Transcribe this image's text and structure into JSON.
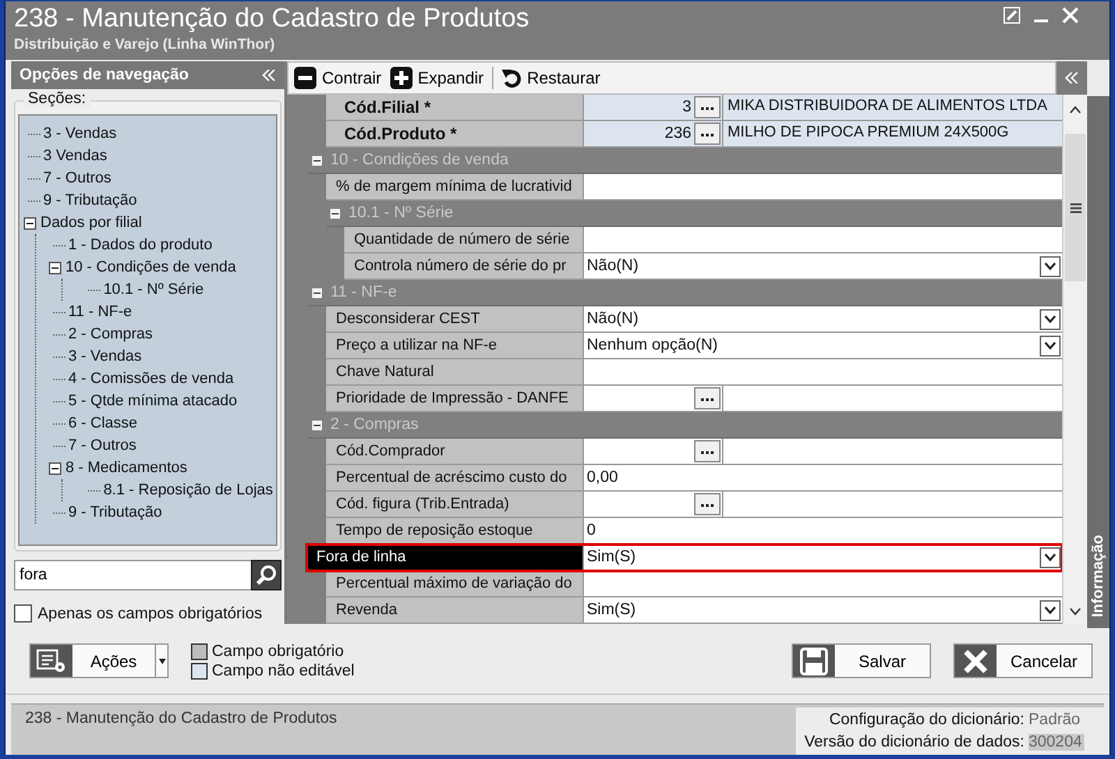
{
  "window": {
    "title": "238 - Manutenção do Cadastro de Produtos",
    "subtitle": "Distribuição e Varejo (Linha WinThor)"
  },
  "navigation": {
    "title": "Opções de navegação",
    "sections_label": "Seções:",
    "tree": [
      {
        "label": "3 - Vendas"
      },
      {
        "label": "3 Vendas"
      },
      {
        "label": "7 - Outros"
      },
      {
        "label": "9 - Tributação"
      },
      {
        "label": "Dados por filial",
        "expanded": true,
        "children": [
          {
            "label": "1 - Dados do produto"
          },
          {
            "label": "10 - Condições de venda",
            "expanded": true,
            "children": [
              {
                "label": "10.1 - Nº Série"
              }
            ]
          },
          {
            "label": "11 - NF-e"
          },
          {
            "label": "2 - Compras"
          },
          {
            "label": "3 - Vendas"
          },
          {
            "label": "4 - Comissões de venda"
          },
          {
            "label": "5 - Qtde mínima atacado"
          },
          {
            "label": "6 - Classe"
          },
          {
            "label": "7 - Outros"
          },
          {
            "label": "8 - Medicamentos",
            "expanded": true,
            "children": [
              {
                "label": "8.1 -  Reposição de Lojas"
              }
            ]
          },
          {
            "label": "9 - Tributação"
          }
        ]
      }
    ],
    "search": {
      "value": "fora"
    },
    "required_only": {
      "label": "Apenas os campos obrigatórios",
      "checked": false
    }
  },
  "toolbar": [
    {
      "kind": "collapse",
      "label": "Contrair"
    },
    {
      "kind": "expand",
      "label": "Expandir"
    },
    {
      "kind": "restore",
      "label": "Restaurar"
    }
  ],
  "grid": {
    "rows": [
      {
        "kind": "lookup",
        "label": "Cód.Filial *",
        "required": true,
        "selected": false,
        "value": "3",
        "description": "MIKA DISTRIBUIDORA DE ALIMENTOS LTDA"
      },
      {
        "kind": "lookup",
        "label": "Cód.Produto *",
        "required": true,
        "selected": false,
        "value": "236",
        "description": "MILHO DE PIPOCA PREMIUM 24X500G"
      },
      {
        "kind": "group",
        "title": "10 - Condições de venda",
        "expanded": true,
        "children": [
          {
            "kind": "text",
            "label": "% de margem mínima de lucrativid",
            "required": false,
            "selected": false
          },
          {
            "kind": "group",
            "title": "10.1 - Nº Série",
            "expanded": true,
            "children": [
              {
                "kind": "text",
                "label": "Quantidade de número de série",
                "required": false,
                "selected": false
              },
              {
                "kind": "dropdown",
                "label": "Controla número de série do pr",
                "required": false,
                "selected": false,
                "value": "Não(N)"
              }
            ]
          }
        ]
      },
      {
        "kind": "group",
        "title": "11 - NF-e",
        "expanded": true,
        "children": [
          {
            "kind": "dropdown",
            "label": "Desconsiderar CEST",
            "required": false,
            "selected": false,
            "value": "Não(N)"
          },
          {
            "kind": "dropdown",
            "label": "Preço a utilizar na NF-e",
            "required": false,
            "selected": false,
            "value": "Nenhum opção(N)"
          },
          {
            "kind": "text",
            "label": "Chave Natural",
            "required": false,
            "selected": false
          },
          {
            "kind": "lookup",
            "label": "Prioridade de Impressão - DANFE",
            "required": false,
            "selected": false
          }
        ]
      },
      {
        "kind": "group",
        "title": "2 - Compras",
        "expanded": true,
        "children": [
          {
            "kind": "lookup",
            "label": "Cód.Comprador",
            "required": false,
            "selected": false
          },
          {
            "kind": "text",
            "label": "Percentual de acréscimo custo do",
            "required": false,
            "selected": false,
            "value": "0,00"
          },
          {
            "kind": "lookup",
            "label": "Cód. figura (Trib.Entrada)",
            "required": false,
            "selected": false
          },
          {
            "kind": "text",
            "label": "Tempo de reposição estoque",
            "required": false,
            "selected": false,
            "value": "0"
          },
          {
            "kind": "dropdown",
            "label": "Fora de linha",
            "required": false,
            "selected": true,
            "value": "Sim(S)"
          },
          {
            "kind": "text",
            "label": "Percentual máximo de variação do",
            "required": false,
            "selected": false
          },
          {
            "kind": "dropdown",
            "label": "Revenda",
            "required": false,
            "selected": false,
            "value": "Sim(S)"
          }
        ]
      }
    ]
  },
  "side_tab": {
    "label": "Informação"
  },
  "actions_button": {
    "label": "Ações"
  },
  "legend": [
    {
      "kind": "required",
      "label": "Campo obrigatório"
    },
    {
      "kind": "readonly",
      "label": "Campo não editável"
    }
  ],
  "buttons": [
    {
      "kind": "save",
      "label": "Salvar"
    },
    {
      "kind": "cancel",
      "label": "Cancelar"
    }
  ],
  "status_bar": {
    "text": "238 - Manutenção do Cadastro de Produtos",
    "dictionary_config_label": "Configuração do dicionário:",
    "dictionary_config_value": "Padrão",
    "dictionary_version_label": "Versão do dicionário de dados:",
    "dictionary_version_value": "300204"
  }
}
